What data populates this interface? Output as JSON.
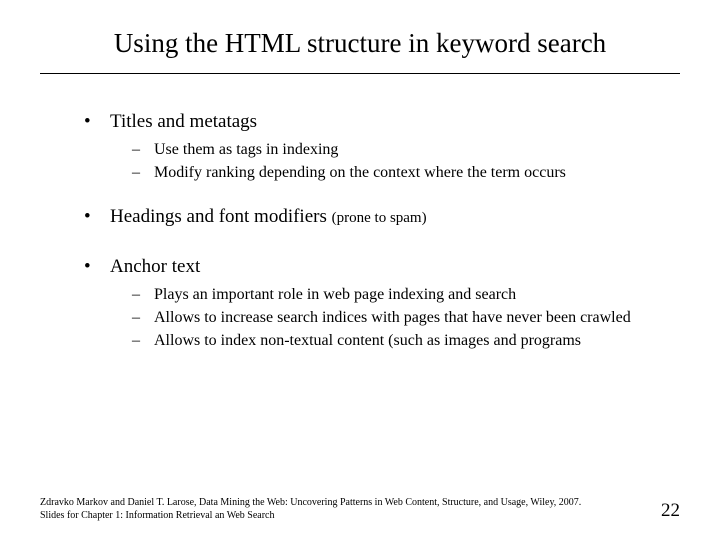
{
  "title": "Using the HTML structure in keyword search",
  "bullets": [
    {
      "text": "Titles and metatags",
      "note": "",
      "subs": [
        "Use them as tags in indexing",
        "Modify ranking depending on the context where the term occurs"
      ]
    },
    {
      "text": "Headings and font modifiers",
      "note": "(prone to spam)",
      "subs": []
    },
    {
      "text": "Anchor text",
      "note": "",
      "subs": [
        "Plays an important role in web page indexing and search",
        "Allows to increase search indices with pages that have never been crawled",
        "Allows to index non-textual content (such as images and programs"
      ]
    }
  ],
  "footer": {
    "line1": "Zdravko Markov and Daniel T. Larose, Data Mining the Web: Uncovering Patterns in Web Content, Structure, and Usage, Wiley, 2007.",
    "line2": "Slides for Chapter 1: Information Retrieval an Web Search"
  },
  "page": "22"
}
